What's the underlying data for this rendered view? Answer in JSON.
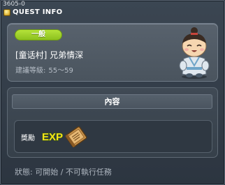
{
  "quest": {
    "id": "3605-0",
    "window_title": "QUEST INFO",
    "type_badge": "一般",
    "name": "[童话村] 兄弟情深",
    "level_label": "建議等級:",
    "level_range": "55～59"
  },
  "content": {
    "header": "內容",
    "reward_label": "獎勵",
    "reward_exp_text": "EXP"
  },
  "status": {
    "text": "狀態: 可開始 / 不可執行任務"
  },
  "colors": {
    "badge_green": "#9ad12a",
    "window_bg": "#343e49",
    "exp_yellow": "#f2e21a"
  },
  "icons": {
    "header": "quest-info-icon",
    "npc": "npc-child-portrait",
    "exp": "exp-icon",
    "book": "skill-book-icon"
  }
}
